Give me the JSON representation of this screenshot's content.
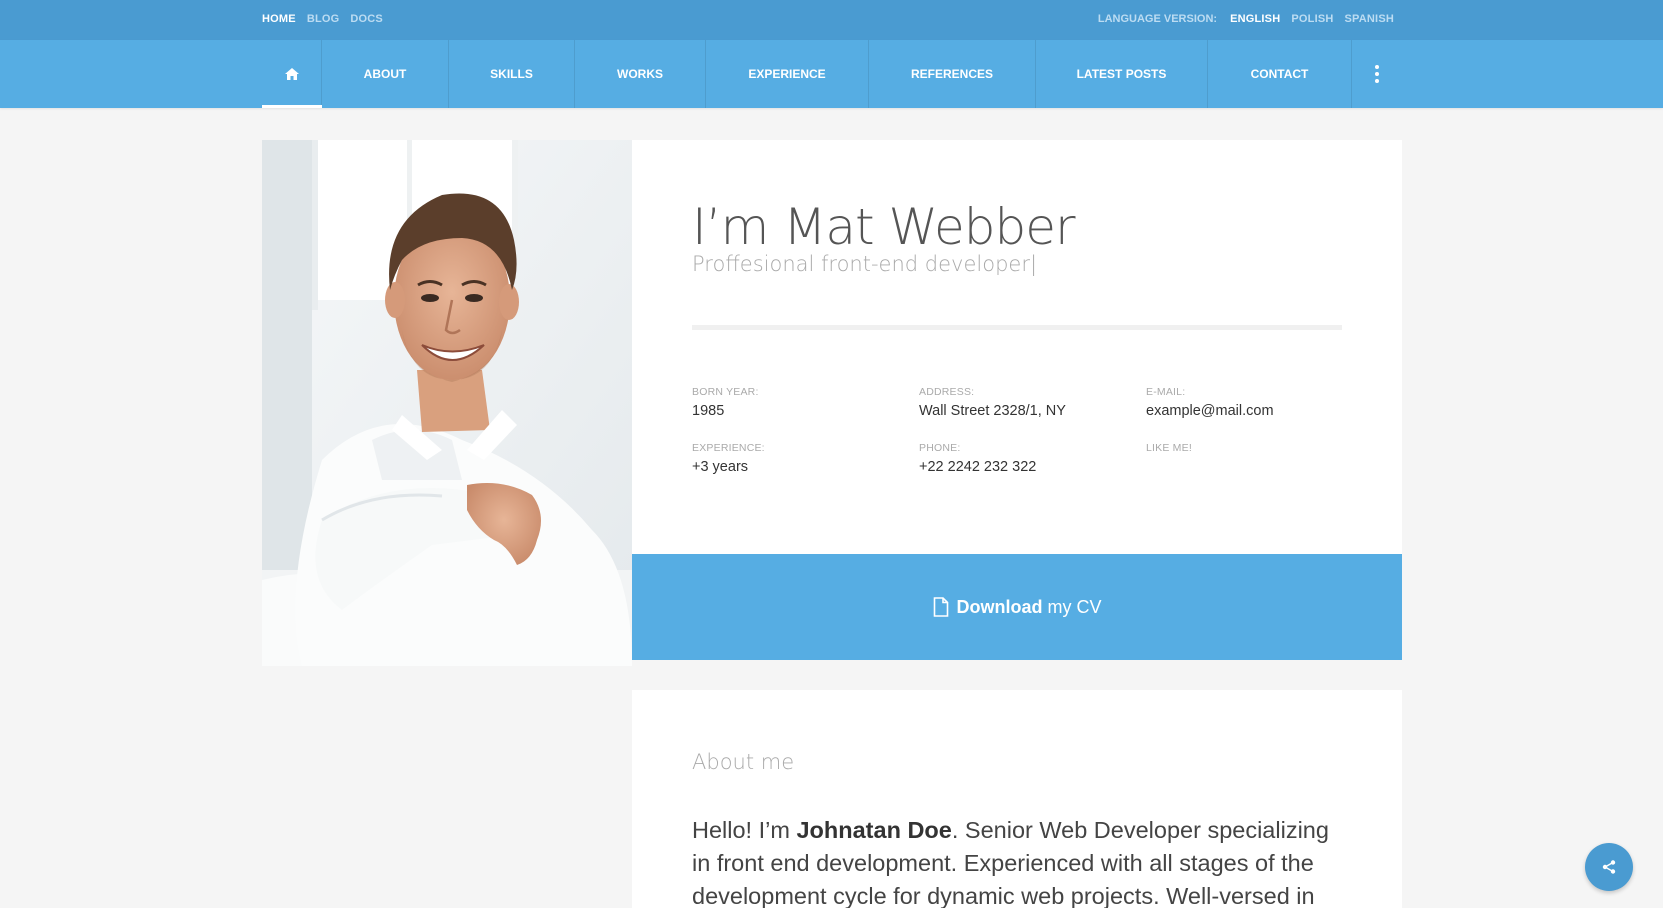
{
  "topbar": {
    "links": [
      "HOME",
      "BLOG",
      "DOCS"
    ],
    "language_label": "LANGUAGE VERSION:",
    "languages": [
      "ENGLISH",
      "POLISH",
      "SPANISH"
    ]
  },
  "nav": {
    "items": [
      "ABOUT",
      "SKILLS",
      "WORKS",
      "EXPERIENCE",
      "REFERENCES",
      "LATEST POSTS",
      "CONTACT"
    ]
  },
  "profile": {
    "name": "I’m Mat Webber",
    "subtitle": "Proffesional front-end developer|",
    "born_label": "BORN YEAR:",
    "born_value": "1985",
    "address_label": "ADDRESS:",
    "address_value": "Wall Street 2328/1, NY",
    "email_label": "E-MAIL:",
    "email_value": "example@mail.com",
    "experience_label": "EXPERIENCE:",
    "experience_value": "+3 years",
    "phone_label": "PHONE:",
    "phone_value": "+22 2242 232 322",
    "like_label": "LIKE ME!"
  },
  "cv": {
    "strong": "Download",
    "rest": "my CV"
  },
  "about": {
    "title": "About me",
    "text_pre": "Hello! I’m ",
    "text_name": "Johnatan Doe",
    "text_post": ". Senior Web Developer specializing in front end development. Experienced with all stages of the development cycle for dynamic web projects. Well-versed in"
  },
  "colors": {
    "topbar": "#4a9bd1",
    "navbar": "#56ade3",
    "accent": "#56ade3",
    "background": "#f5f5f5"
  },
  "icons": {
    "home": "home-icon",
    "more": "more-vertical-icon",
    "file": "file-icon",
    "share": "share-icon"
  }
}
